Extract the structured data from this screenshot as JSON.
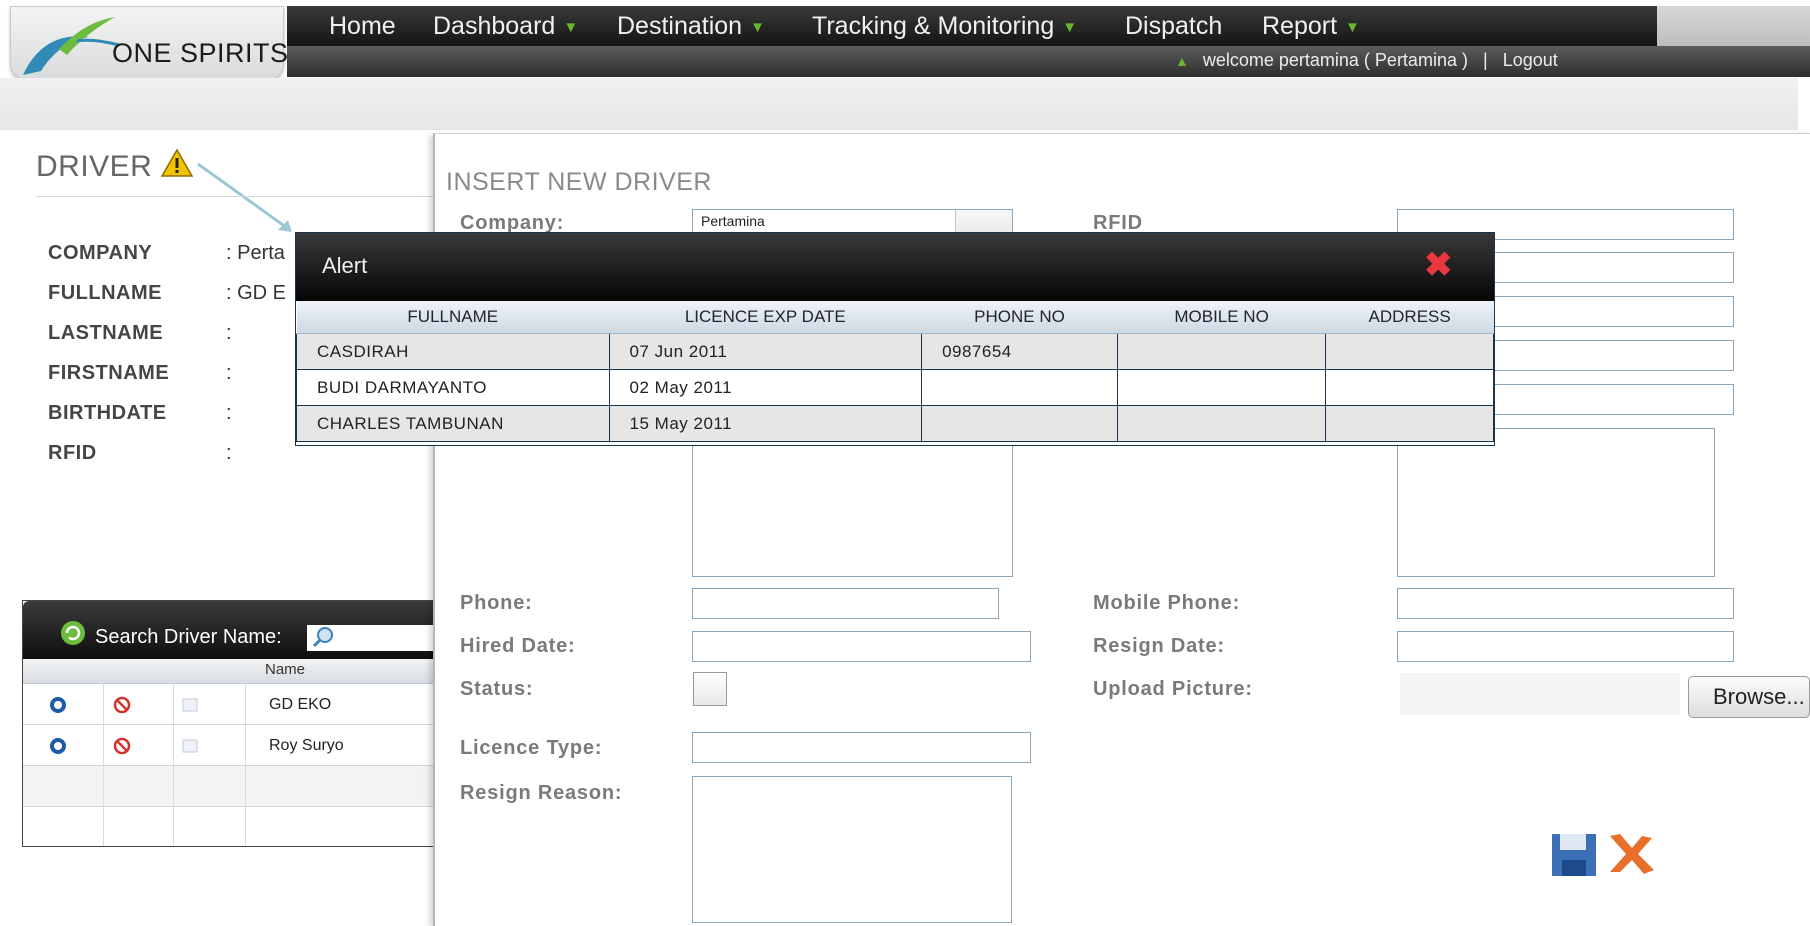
{
  "header": {
    "logo_text": "ONE SPIRITS",
    "nav": [
      {
        "label": "Home",
        "dropdown": false
      },
      {
        "label": "Dashboard",
        "dropdown": true
      },
      {
        "label": "Destination",
        "dropdown": true
      },
      {
        "label": "Tracking & Monitoring",
        "dropdown": true
      },
      {
        "label": "Dispatch",
        "dropdown": false
      },
      {
        "label": "Report",
        "dropdown": true
      }
    ],
    "welcome": "welcome pertamina ( Pertamina )",
    "separator": "|",
    "logout": "Logout"
  },
  "driver_panel": {
    "title": "DRIVER",
    "fields": [
      {
        "label": "COMPANY",
        "value": ": Perta"
      },
      {
        "label": "FULLNAME",
        "value": ": GD E"
      },
      {
        "label": "LASTNAME",
        "value": ":"
      },
      {
        "label": "FIRSTNAME",
        "value": ":"
      },
      {
        "label": "BIRTHDATE",
        "value": ":"
      },
      {
        "label": "RFID",
        "value": ":"
      }
    ]
  },
  "search_grid": {
    "search_label": "Search Driver Name:",
    "column_name": "Name",
    "rows": [
      "GD EKO",
      "Roy Suryo"
    ]
  },
  "insert_form": {
    "title": "INSERT NEW DRIVER",
    "company_label": "Company:",
    "company_value": "Pertamina",
    "rfid_label": "RFID",
    "phone_label": "Phone:",
    "mobile_label": "Mobile Phone:",
    "hired_label": "Hired Date:",
    "resign_date_label": "Resign Date:",
    "status_label": "Status:",
    "upload_label": "Upload Picture:",
    "browse": "Browse...",
    "licence_label": "Licence Type:",
    "resign_reason_label": "Resign Reason:"
  },
  "alert": {
    "title": "Alert",
    "columns": [
      "FULLNAME",
      "LICENCE EXP DATE",
      "PHONE NO",
      "MOBILE NO",
      "ADDRESS"
    ],
    "rows": [
      [
        "CASDIRAH",
        "07 Jun 2011",
        "0987654",
        "",
        ""
      ],
      [
        "BUDI DARMAYANTO",
        "02 May 2011",
        "",
        "",
        ""
      ],
      [
        "CHARLES TAMBUNAN",
        "15 May 2011",
        "",
        "",
        ""
      ]
    ]
  },
  "colors": {
    "nav_bg": "#1e1e1e",
    "accent_green": "#64b72e",
    "close_red": "#e8383d",
    "input_border": "#8aa6bd",
    "save_blue": "#3b6fb6",
    "cancel_orange": "#e8702a"
  }
}
